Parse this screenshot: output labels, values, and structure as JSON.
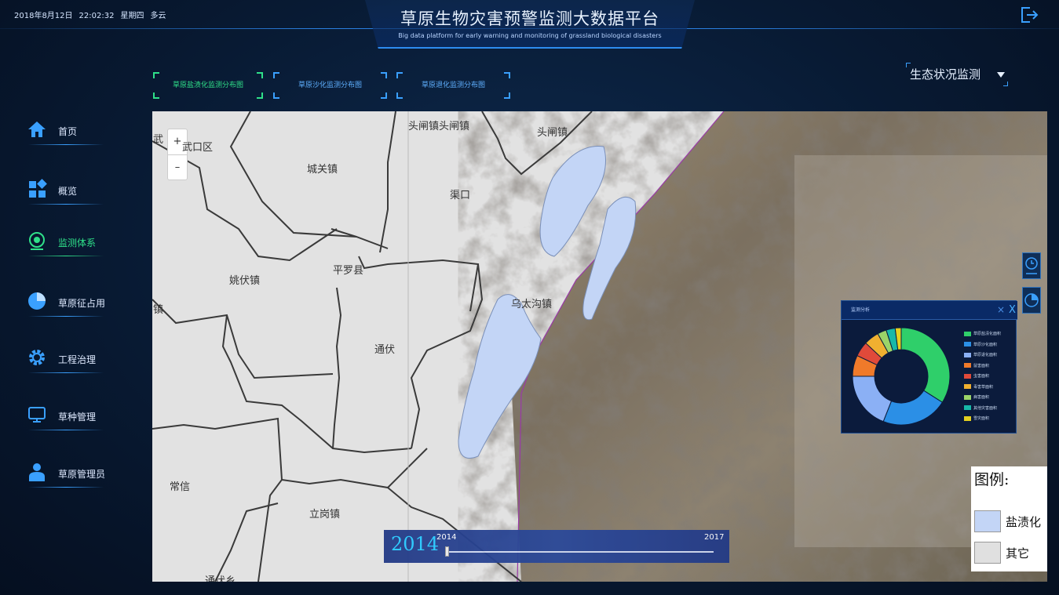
{
  "header": {
    "date": "2018年8月12日",
    "time": "22:02:32",
    "weekday": "星期四",
    "weather": "多云",
    "title": "草原生物灾害预警监测大数据平台",
    "subtitle": "Big data platform for early warning and monitoring of grassland biological disasters",
    "logout_icon": "logout-icon"
  },
  "sidebar": {
    "items": [
      {
        "label": "首页",
        "icon": "home-icon"
      },
      {
        "label": "概览",
        "icon": "grid-icon"
      },
      {
        "label": "监测体系",
        "icon": "monitor-icon",
        "active": true
      },
      {
        "label": "草原征占用",
        "icon": "pie-icon"
      },
      {
        "label": "工程治理",
        "icon": "gear-icon"
      },
      {
        "label": "草种管理",
        "icon": "screen-icon"
      },
      {
        "label": "草原管理员",
        "icon": "person-icon"
      }
    ]
  },
  "tabs": [
    {
      "label": "草原盐渍化监测分布图",
      "active": true
    },
    {
      "label": "草原沙化监测分布图",
      "active": false
    },
    {
      "label": "草原退化监测分布图",
      "active": false
    }
  ],
  "dropdown": {
    "selected": "生态状况监测"
  },
  "map": {
    "zoom_in": "+",
    "zoom_out": "–",
    "places": [
      "头闸镇头闸镇",
      "头闸镇",
      "武口区",
      "武",
      "城关镇",
      "渠口",
      "平罗县",
      "姚伏镇",
      "镇",
      "乌太沟镇",
      "通伏",
      "常信",
      "立岗镇",
      "通伏乡"
    ],
    "legend": {
      "title": "图例:",
      "items": [
        {
          "label": "盐渍化",
          "color": "#c3d5f6"
        },
        {
          "label": "其它",
          "color": "#e0e0e0"
        }
      ]
    },
    "timeline": {
      "current_year": "2014",
      "start_year": "2014",
      "end_year": "2017",
      "progress": 0
    }
  },
  "popup": {
    "title": "监测分析",
    "close": "×",
    "close2": "X",
    "donut": [
      {
        "label": "草原盐渍化面积",
        "value": 34,
        "color": "#2fcf6a"
      },
      {
        "label": "草原沙化面积",
        "value": 22,
        "color": "#2b8fe6"
      },
      {
        "label": "草原退化面积",
        "value": 19,
        "color": "#8bb0f5"
      },
      {
        "label": "鼠害面积",
        "value": 7,
        "color": "#f07a2a"
      },
      {
        "label": "虫害面积",
        "value": 5,
        "color": "#e04a3a"
      },
      {
        "label": "毒害草面积",
        "value": 5,
        "color": "#f0b030"
      },
      {
        "label": "病害面积",
        "value": 3,
        "color": "#9bd468"
      },
      {
        "label": "其他灾害面积",
        "value": 3,
        "color": "#17b8a8"
      },
      {
        "label": "雪灾面积",
        "value": 2,
        "color": "#e4d020"
      }
    ]
  }
}
